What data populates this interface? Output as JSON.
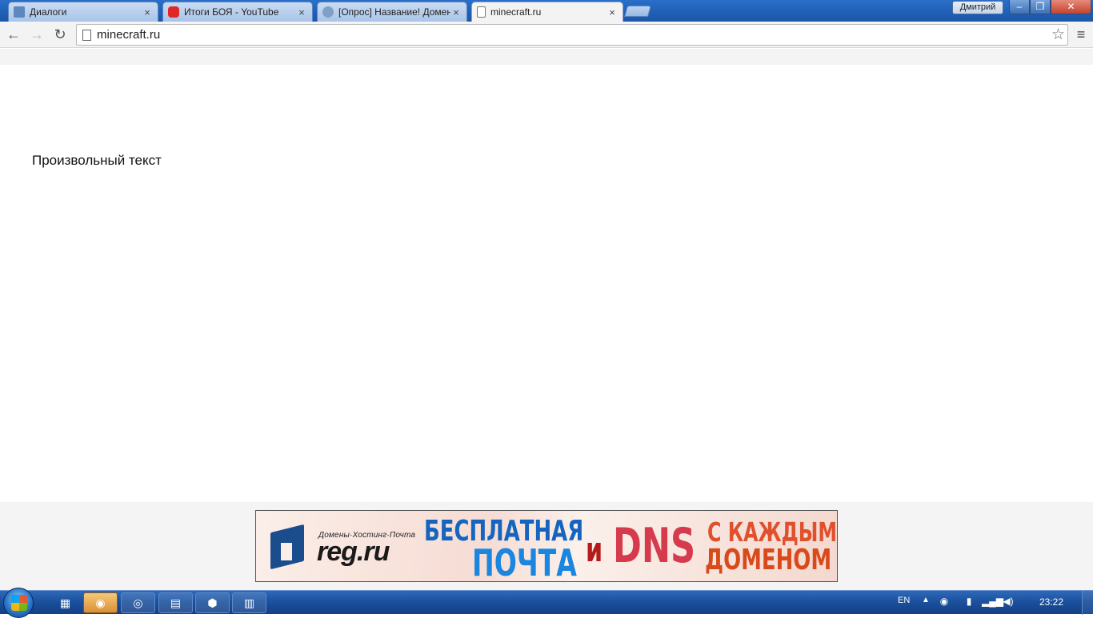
{
  "browser": {
    "tabs": [
      {
        "label": "Диалоги",
        "favicon": "vk-message-icon",
        "active": false
      },
      {
        "label": "Итоги БОЯ - YouTube",
        "favicon": "youtube-icon",
        "active": false
      },
      {
        "label": "[Опрос] Название! Домен",
        "favicon": "forum-icon",
        "active": false
      },
      {
        "label": "minecraft.ru",
        "favicon": "page-icon",
        "active": true
      }
    ],
    "tab_close": "×",
    "user_name": "Дмитрий",
    "window_controls": {
      "minimize": "–",
      "maximize": "❐",
      "close": "✕"
    },
    "toolbar": {
      "back": "←",
      "forward": "→",
      "reload": "↻",
      "star": "☆",
      "menu": "≡"
    },
    "address": "minecraft.ru"
  },
  "page": {
    "text": "Произвольный текст"
  },
  "banner": {
    "tagline": "Домены·Хостинг·Почта",
    "brand": "reg.ru",
    "line_free": "БЕСПЛАТНАЯ",
    "line_mail": "ПОЧТА",
    "line_and": "и",
    "line_dns": "DNS",
    "line_each": "С КАЖДЫМ",
    "line_domain": "ДОМЕНОМ"
  },
  "taskbar": {
    "items": [
      {
        "name": "explorer-icon",
        "glyph": "▦"
      },
      {
        "name": "steam-icon",
        "glyph": "◉"
      },
      {
        "name": "chrome-icon",
        "glyph": "◎"
      },
      {
        "name": "calendar-app-icon",
        "glyph": "▤"
      },
      {
        "name": "cube-app-icon",
        "glyph": "⬢"
      },
      {
        "name": "calculator-icon",
        "glyph": "▥"
      }
    ],
    "lang": "EN",
    "tray_arrow": "▲",
    "clock": "23:22"
  },
  "colors": {
    "chrome_active_tab": "#f3f3f3",
    "taskbar": "#1a4f9c",
    "banner_blue": "#1564c0",
    "banner_red": "#d63a4d"
  }
}
